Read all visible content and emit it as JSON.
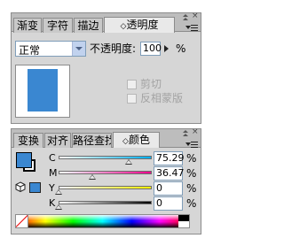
{
  "transparency_panel": {
    "tabs": [
      {
        "label": "渐变"
      },
      {
        "label": "字符"
      },
      {
        "label": "描边"
      },
      {
        "label": "透明度",
        "icon": "diamond-icon",
        "active": true
      }
    ],
    "blend_mode": "正常",
    "opacity_label": "不透明度:",
    "opacity_value": "100",
    "opacity_unit": "%",
    "clip_label": "剪切",
    "invert_mask_label": "反相蒙版",
    "thumbnail_color": "#3a87d1"
  },
  "color_panel": {
    "tabs": [
      {
        "label": "变换"
      },
      {
        "label": "对齐"
      },
      {
        "label": "路径查找"
      },
      {
        "label": "颜色",
        "icon": "diamond-icon",
        "active": true
      }
    ],
    "fill_color": "#3a87d1",
    "channels": [
      {
        "label": "C",
        "value": "75.29",
        "unit": "%",
        "level": 0.7529
      },
      {
        "label": "M",
        "value": "36.47",
        "unit": "%",
        "level": 0.3647
      },
      {
        "label": "Y",
        "value": "0",
        "unit": "%",
        "level": 0
      },
      {
        "label": "K",
        "value": "0",
        "unit": "%",
        "level": 0
      }
    ]
  }
}
